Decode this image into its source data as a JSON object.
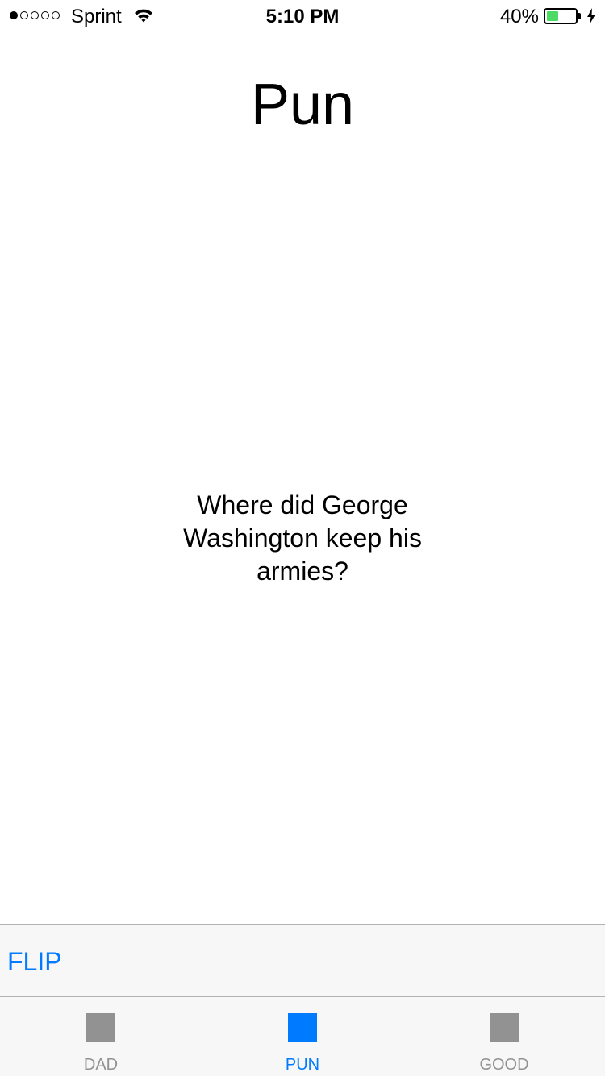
{
  "status_bar": {
    "signal": {
      "filled": 1,
      "total": 5
    },
    "carrier": "Sprint",
    "time": "5:10 PM",
    "battery_percent_text": "40%",
    "battery_level": 0.4,
    "battery_color": "#4cd964",
    "icons": [
      "wifi-icon",
      "battery-icon",
      "charging-bolt-icon"
    ]
  },
  "header": {
    "title": "Pun"
  },
  "card": {
    "question": "Where did George Washington keep his armies?"
  },
  "toolbar": {
    "flip_label": "FLIP"
  },
  "tab_bar": {
    "tabs": [
      {
        "label": "DAD",
        "active": false,
        "icon": "square-icon"
      },
      {
        "label": "PUN",
        "active": true,
        "icon": "square-icon"
      },
      {
        "label": "GOOD",
        "active": false,
        "icon": "square-icon"
      }
    ]
  },
  "colors": {
    "accent": "#007aff",
    "inactive": "#929292",
    "bar_background": "#f7f7f7"
  }
}
